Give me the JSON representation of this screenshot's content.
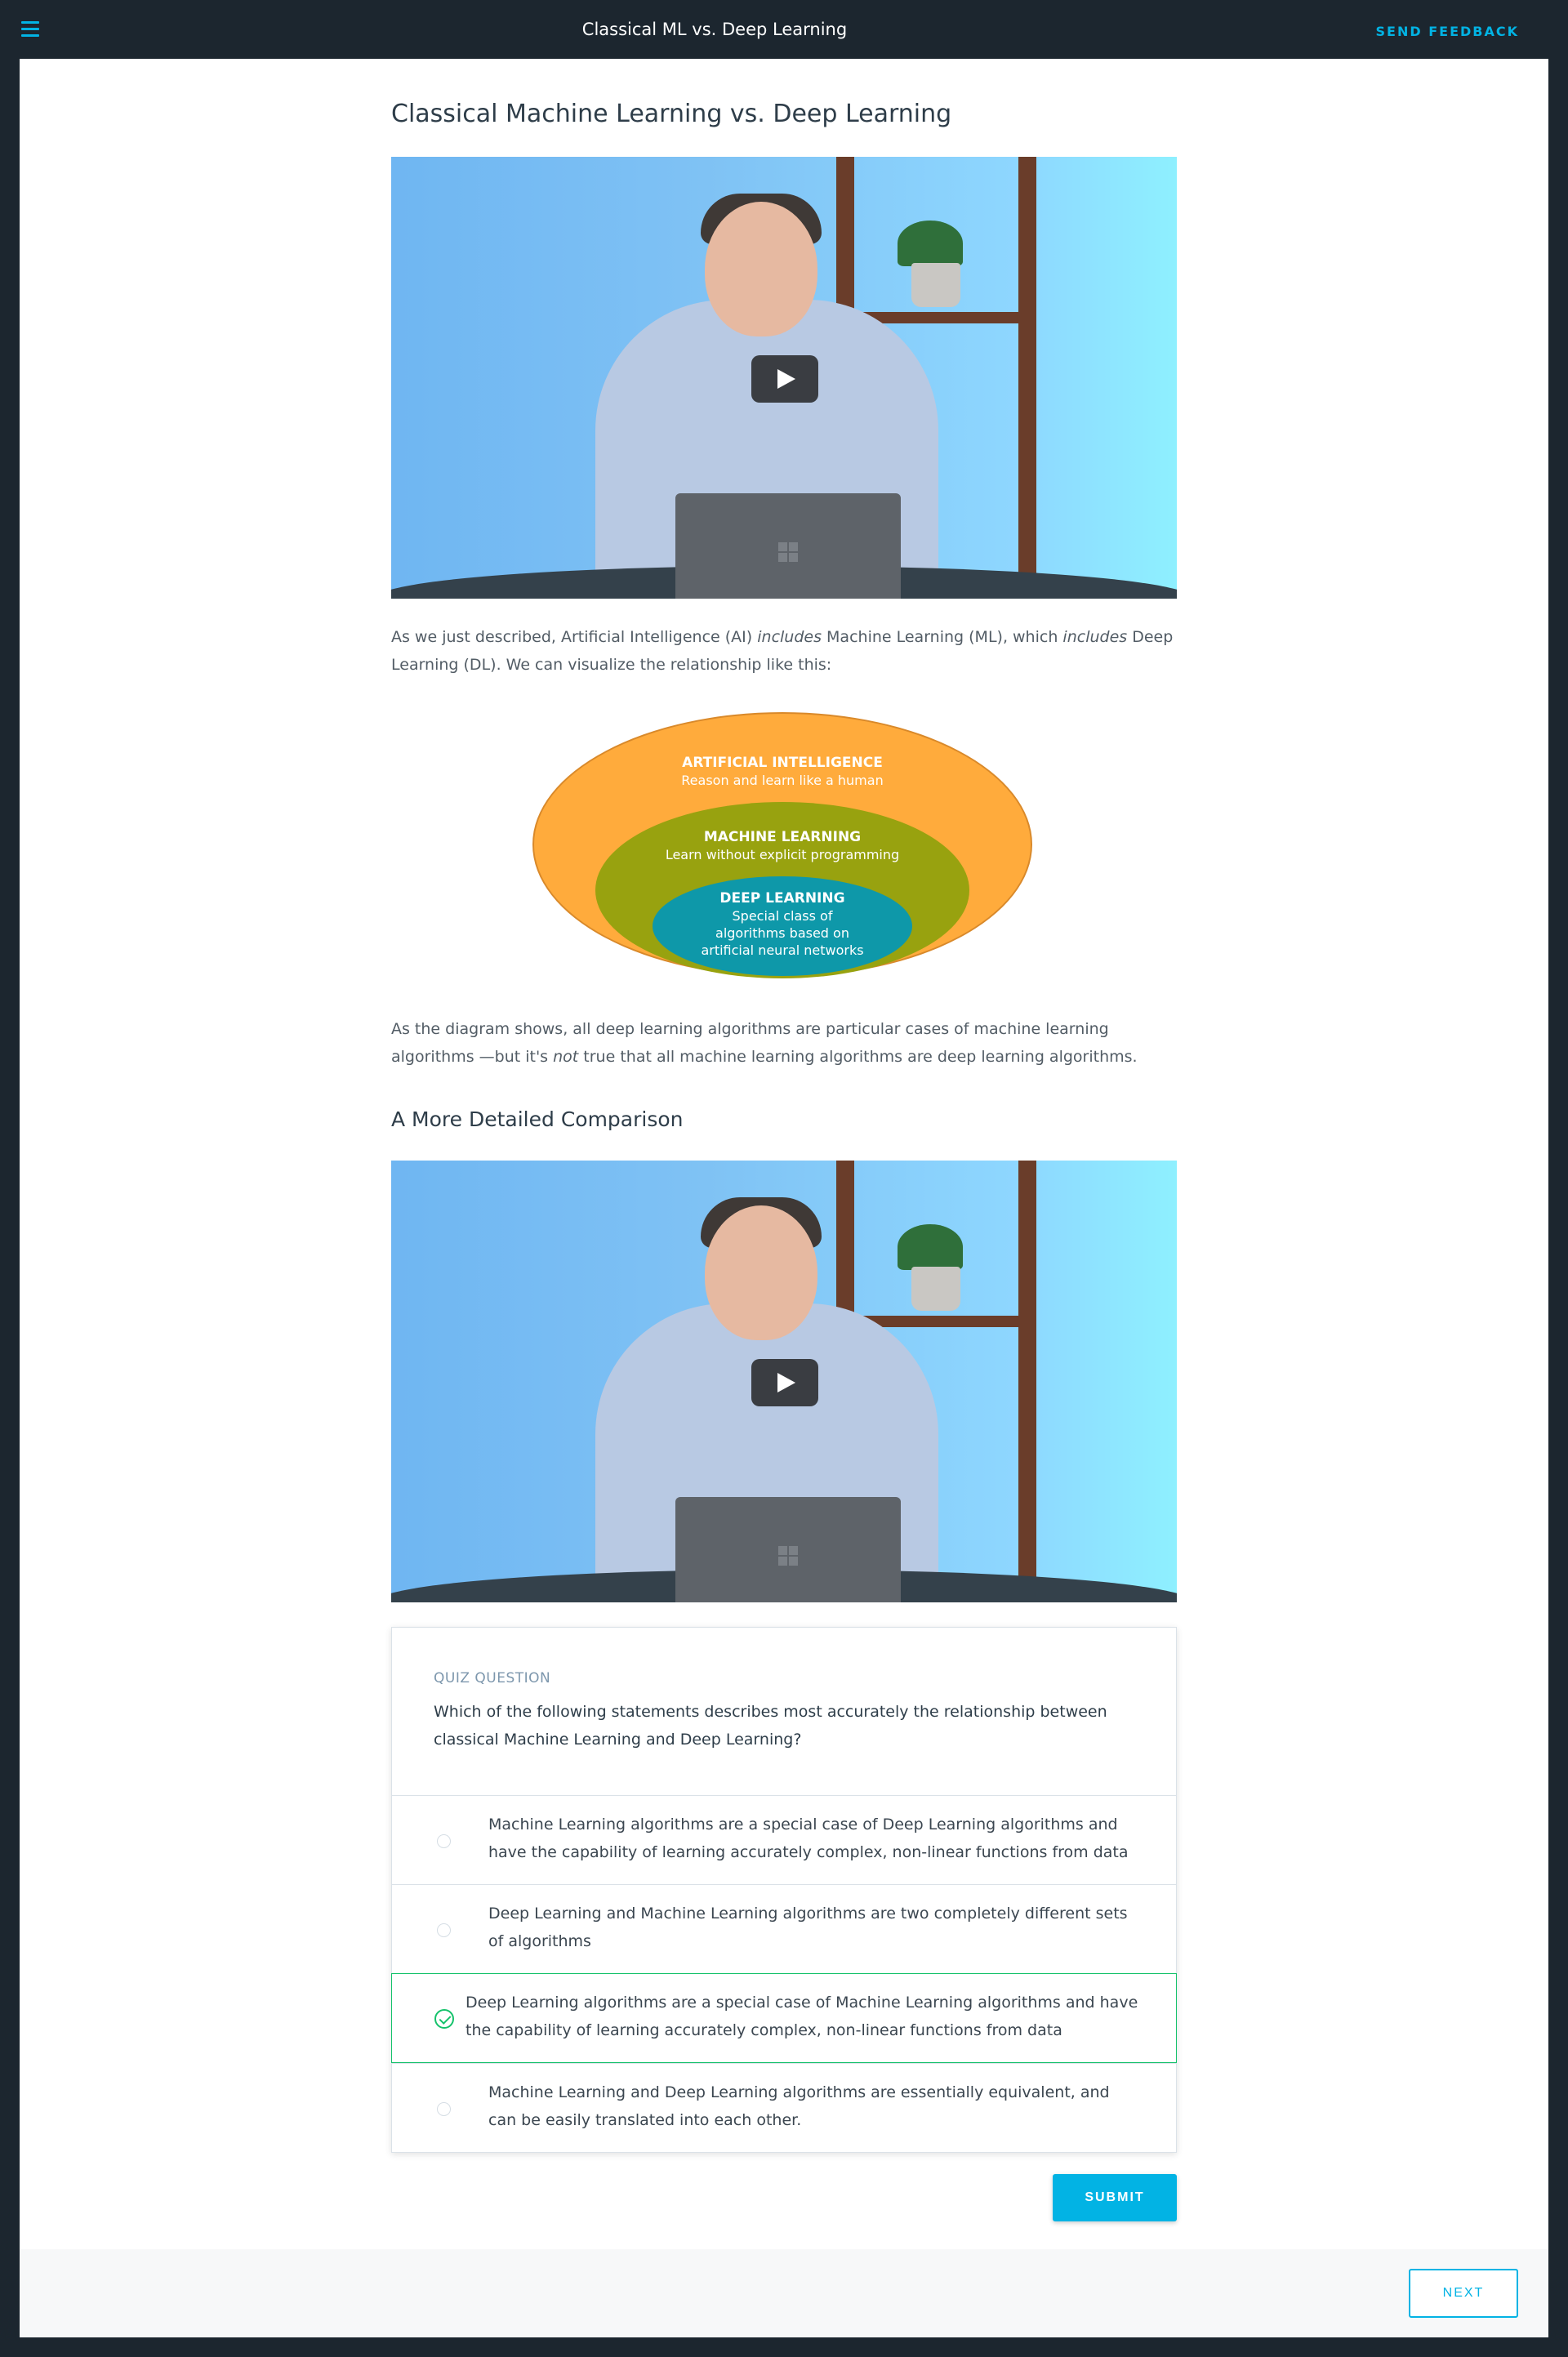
{
  "header": {
    "title": "Classical ML vs. Deep Learning",
    "feedback_label": "SEND FEEDBACK"
  },
  "lesson": {
    "title": "Classical Machine Learning vs. Deep Learning",
    "para1": {
      "a": "As we just described, Artificial Intelligence (AI) ",
      "b": "includes",
      "c": " Machine Learning (ML), which ",
      "d": "includes",
      "e": " Deep Learning (DL). We can visualize the relationship like this:"
    },
    "diagram": {
      "ai_title": "ARTIFICIAL INTELLIGENCE",
      "ai_desc": "Reason and learn like a human",
      "ml_title": "MACHINE LEARNING",
      "ml_desc": "Learn without explicit programming",
      "dl_title": "DEEP LEARNING",
      "dl_line1": "Special class of",
      "dl_line2": "algorithms based on",
      "dl_line3": "artificial neural networks"
    },
    "para2": {
      "a": "As the diagram shows, all deep learning algorithms are particular cases of machine learning algorithms —but it's ",
      "b": "not",
      "c": " true that all machine learning algorithms are deep learning algorithms."
    },
    "subheading": "A More Detailed Comparison"
  },
  "quiz": {
    "label": "QUIZ QUESTION",
    "question": "Which of the following statements describes most accurately the relationship between classical Machine Learning and Deep Learning?",
    "options": [
      "Machine Learning algorithms are a special case of Deep Learning algorithms and have the capability of learning accurately complex, non-linear functions from data",
      "Deep Learning and Machine Learning algorithms are two completely different sets of algorithms",
      "Deep Learning algorithms are a special case of Machine Learning algorithms and have the capability of learning accurately complex, non-linear functions from data",
      "Machine Learning and Deep Learning algorithms are essentially equivalent, and can be easily translated into each other."
    ],
    "selected_index": 2,
    "submit_label": "SUBMIT"
  },
  "footer": {
    "next_label": "NEXT"
  },
  "colors": {
    "accent": "#02b3e4",
    "selected": "#15c26b",
    "ai_ring": "#ffab3c",
    "ml_ring": "#98a20f",
    "dl_ring": "#0e98a9"
  }
}
